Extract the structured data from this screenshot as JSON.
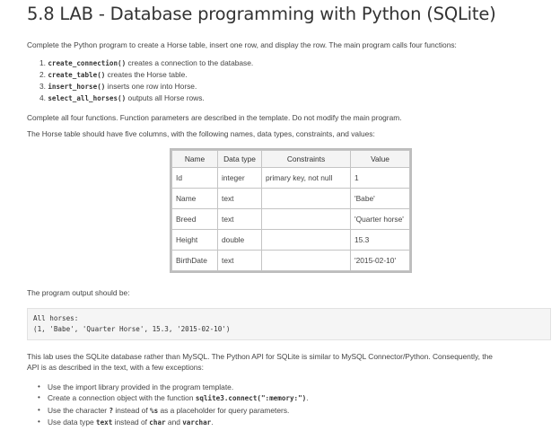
{
  "title": "5.8 LAB - Database programming with Python (SQLite)",
  "intro": "Complete the Python program to create a Horse table, insert one row, and display the row. The main program calls four functions:",
  "functions": [
    {
      "num": "1.",
      "code": "create_connection()",
      "text": " creates a connection to the database."
    },
    {
      "num": "2.",
      "code": "create_table()",
      "text": " creates the Horse table."
    },
    {
      "num": "3.",
      "code": "insert_horse()",
      "text": " inserts one row into Horse."
    },
    {
      "num": "4.",
      "code": "select_all_horses()",
      "text": " outputs all Horse rows."
    }
  ],
  "complete_text": "Complete all four functions. Function parameters are described in the template. Do not modify the main program.",
  "horse_text": "The Horse table should have five columns, with the following names, data types, constraints, and values:",
  "table": {
    "headers": [
      "Name",
      "Data type",
      "Constraints",
      "Value"
    ],
    "rows": [
      [
        "Id",
        "integer",
        "primary key, not null",
        "1"
      ],
      [
        "Name",
        "text",
        "",
        "'Babe'"
      ],
      [
        "Breed",
        "text",
        "",
        "'Quarter horse'"
      ],
      [
        "Height",
        "double",
        "",
        "15.3"
      ],
      [
        "BirthDate",
        "text",
        "",
        "'2015-02-10'"
      ]
    ]
  },
  "output_text": "The program output should be:",
  "output_lines": [
    "All horses:",
    "(1, 'Babe', 'Quarter Horse', 15.3, '2015-02-10')"
  ],
  "lab_text_1": "This lab uses the SQLite database rather than MySQL. The Python API for SQLite is similar to MySQL Connector/Python. Consequently, the",
  "lab_text_2": "API is as described in the text, with a few exceptions:",
  "exceptions": {
    "e1": "Use the import library provided in the program template.",
    "e2_pre": "Create a connection object with the function ",
    "e2_code": "sqlite3.connect(\":memory:\")",
    "e2_post": ".",
    "e3_pre": "Use the character ",
    "e3_code1": "?",
    "e3_mid": " instead of ",
    "e3_code2": "%s",
    "e3_post": " as a placeholder for query parameters.",
    "e4_pre": "Use data type ",
    "e4_code1": "text",
    "e4_mid1": " instead of ",
    "e4_code2": "char",
    "e4_mid2": " and ",
    "e4_code3": "varchar",
    "e4_post": "."
  },
  "bullet": "•"
}
